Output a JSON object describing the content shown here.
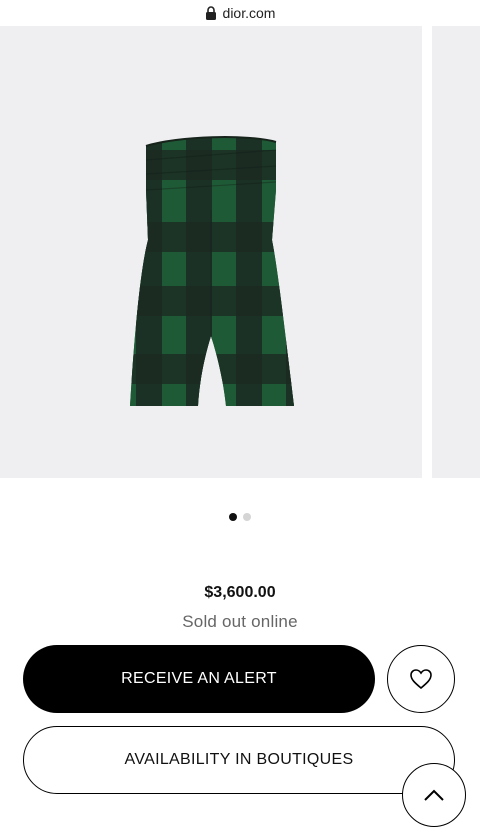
{
  "browser": {
    "url": "dior.com"
  },
  "gallery": {
    "slides_count": 2,
    "active_slide": 1
  },
  "product": {
    "price": "$3,600.00",
    "availability": "Sold out online"
  },
  "actions": {
    "alert_label": "RECEIVE AN ALERT",
    "boutique_label": "AVAILABILITY IN BOUTIQUES"
  },
  "icons": {
    "lock": "lock-icon",
    "wishlist": "heart-icon",
    "back_to_top": "chevron-up-icon"
  },
  "colors": {
    "primary": "#000000",
    "image_background": "#efeff2",
    "muted_text": "#666666",
    "plaid_green": "#1f5a36",
    "plaid_dark": "#1c2a22"
  }
}
